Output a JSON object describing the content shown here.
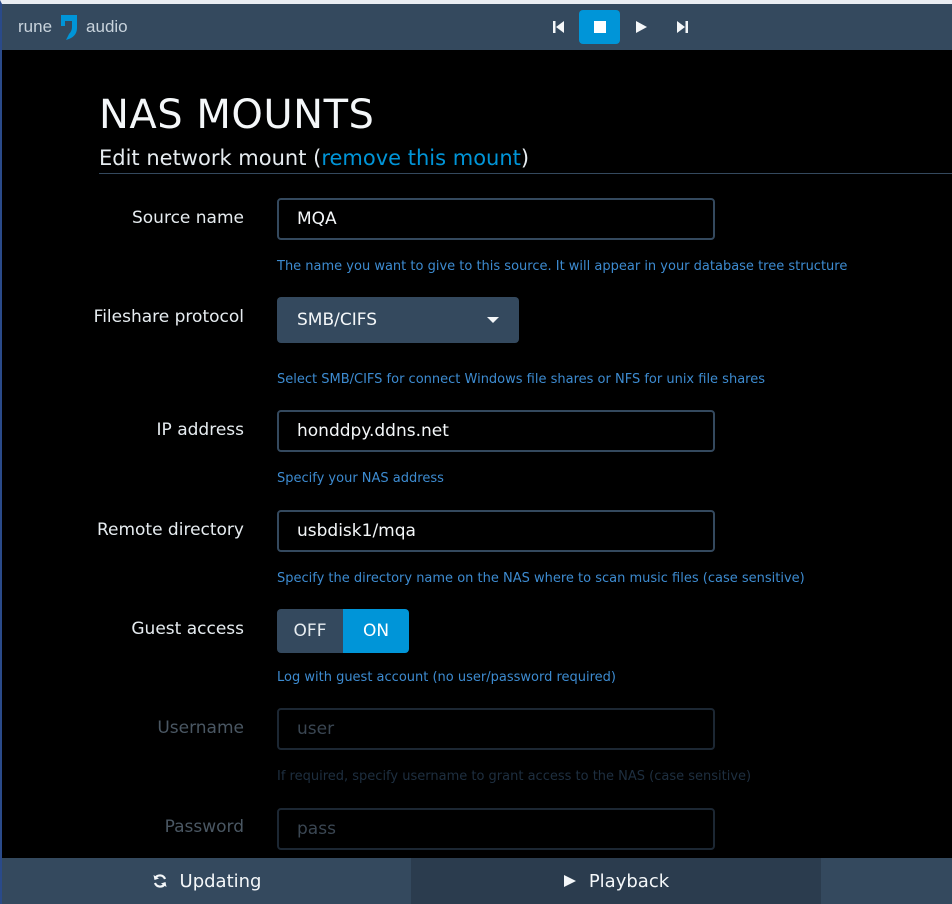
{
  "app": {
    "logo_left": "rune",
    "logo_right": "audio"
  },
  "transport": {
    "items": [
      {
        "icon": "skip-previous-icon"
      },
      {
        "icon": "stop-icon",
        "active": true
      },
      {
        "icon": "play-icon"
      },
      {
        "icon": "skip-next-icon"
      }
    ]
  },
  "page": {
    "title": "NAS MOUNTS",
    "heading_prefix": "Edit network mount (",
    "heading_link": "remove this mount",
    "heading_suffix": ")"
  },
  "form": {
    "source_name": {
      "label": "Source name",
      "value": "MQA",
      "help": "The name you want to give to this source. It will appear in your database tree structure"
    },
    "protocol": {
      "label": "Fileshare protocol",
      "value": "SMB/CIFS",
      "help": "Select SMB/CIFS for connect Windows file shares or NFS for unix file shares"
    },
    "ip_address": {
      "label": "IP address",
      "value": "honddpy.ddns.net",
      "help": "Specify your NAS address"
    },
    "remote_directory": {
      "label": "Remote directory",
      "value": "usbdisk1/mqa",
      "help": "Specify the directory name on the NAS where to scan music files (case sensitive)"
    },
    "guest_access": {
      "label": "Guest access",
      "off_label": "OFF",
      "on_label": "ON",
      "state": "ON",
      "help": "Log with guest account (no user/password required)"
    },
    "username": {
      "label": "Username",
      "placeholder": "user",
      "help": "If required, specify username to grant access to the NAS (case sensitive)"
    },
    "password": {
      "label": "Password",
      "placeholder": "pass"
    }
  },
  "bottom": {
    "updating_label": "Updating",
    "playback_label": "Playback"
  },
  "colors": {
    "accent": "#0095d8",
    "bar": "#34495e",
    "background": "#000000"
  }
}
